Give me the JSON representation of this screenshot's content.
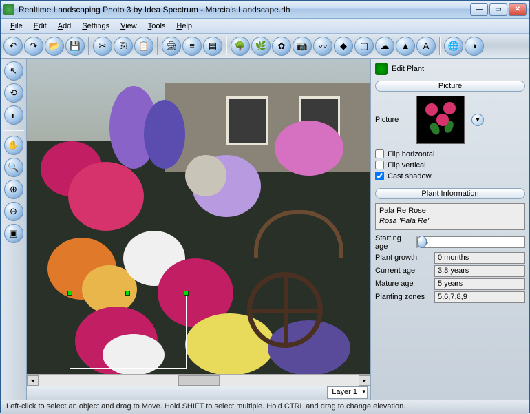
{
  "window": {
    "title": "Realtime Landscaping Photo 3 by Idea Spectrum - Marcia's Landscape.rlh"
  },
  "menu": {
    "file": "File",
    "edit": "Edit",
    "add": "Add",
    "settings": "Settings",
    "view": "View",
    "tools": "Tools",
    "help": "Help"
  },
  "layer": {
    "label": "Layer 1"
  },
  "panel": {
    "title": "Edit Plant",
    "section_picture": "Picture",
    "picture_label": "Picture",
    "flip_h": "Flip horizontal",
    "flip_v": "Flip vertical",
    "cast_shadow": "Cast shadow",
    "section_info": "Plant Information",
    "plant_common": "Pala Re Rose",
    "plant_sci": "Rosa 'Pala Re'",
    "starting_age_label": "Starting age",
    "starting_age_val": "4",
    "plant_growth_label": "Plant growth",
    "plant_growth_val": "0 months",
    "current_age_label": "Current age",
    "current_age_val": "3.8 years",
    "mature_age_label": "Mature age",
    "mature_age_val": "5 years",
    "zones_label": "Planting zones",
    "zones_val": "5,6,7,8,9"
  },
  "status": {
    "text": "Left-click to select an object and drag to Move. Hold SHIFT to select multiple. Hold CTRL and drag to change elevation."
  }
}
